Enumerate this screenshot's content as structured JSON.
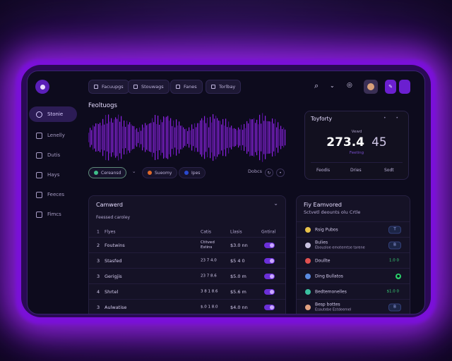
{
  "sidebar": {
    "items": [
      {
        "label": "Stonie"
      },
      {
        "label": "Lenelly"
      },
      {
        "label": "Dutis"
      },
      {
        "label": "Hays"
      },
      {
        "label": "Feeces"
      },
      {
        "label": "Fimcs"
      }
    ]
  },
  "header": {
    "chips": [
      {
        "label": "Facuupgs"
      },
      {
        "label": "Stouwags"
      },
      {
        "label": "Fanes"
      },
      {
        "label": "Torlbay"
      }
    ]
  },
  "waveform": {
    "title": "Feoltuogs",
    "pills": [
      {
        "label": "Cereansd",
        "color": "#3fbf8a"
      },
      {
        "label": "Sueomy",
        "color": "#e06a2a"
      },
      {
        "label": "Ipes",
        "color": "#2a4ad0"
      }
    ],
    "right_label": "Dobcs",
    "colors": {
      "wave": "#8a22e0",
      "wave_dark": "#4a0f8a"
    }
  },
  "stat_card": {
    "title": "Toyforty",
    "label": "Vewd",
    "main_value": "273.4",
    "secondary_value": "45",
    "sub_label": "Feeting",
    "footer": [
      "Feodis",
      "Dries",
      "Sodt"
    ]
  },
  "table": {
    "title": "Camwerd",
    "subtitle": "Feessed caroley",
    "columns": [
      "Flyes",
      "Catis",
      "Llasis",
      "Gntiral"
    ],
    "rows": [
      {
        "num": "2",
        "name": "Foutwins",
        "a1": "Ctitved",
        "a2": "Estins",
        "b": "$3.0 nn"
      },
      {
        "num": "3",
        "name": "Stasfed",
        "a1": "23 7 4.0",
        "a2": "",
        "b": "$5 4 0"
      },
      {
        "num": "3",
        "name": "Gerigjis",
        "a1": "23 7 8.6",
        "a2": "",
        "b": "$5.0 m"
      },
      {
        "num": "4",
        "name": "Shrtel",
        "a1": "3 8 1 8.6",
        "a2": "",
        "b": "$5.6 m"
      },
      {
        "num": "3",
        "name": "Aulwatise",
        "a1": "$.0 1 8.0",
        "a2": "",
        "b": "$4.0 nn"
      }
    ]
  },
  "list": {
    "title": "Fiy Eamvored",
    "subtitle": "Sctvetl deounts olu Crtle",
    "items": [
      {
        "line1": "Rsig Pubos",
        "line2": "",
        "icon_color": "#e8c24a",
        "badge": "T",
        "badge_style": "badge-blue"
      },
      {
        "line1": "Bulies",
        "line2": "Ebousloe emotemtse tarene",
        "icon_color": "#c9c2e0",
        "badge": "B",
        "badge_style": "badge-blue"
      },
      {
        "line1": "Doullte",
        "line2": "",
        "icon_color": "#e05050",
        "badge": "1.0 0",
        "badge_style": "badge-green"
      },
      {
        "line1": "Ding Bullatos",
        "line2": "",
        "icon_color": "#5a8ae0",
        "badge": "●",
        "badge_style": "badge-dot"
      },
      {
        "line1": "Bedtemonelles",
        "line2": "",
        "icon_color": "#3ac0a0",
        "badge": "$1.0 0",
        "badge_style": "badge-green"
      },
      {
        "line1": "Besp bottes",
        "line2": "Esautebe Estdeemel",
        "icon_color": "#e0a080",
        "badge": "B",
        "badge_style": "badge-blue"
      }
    ]
  }
}
